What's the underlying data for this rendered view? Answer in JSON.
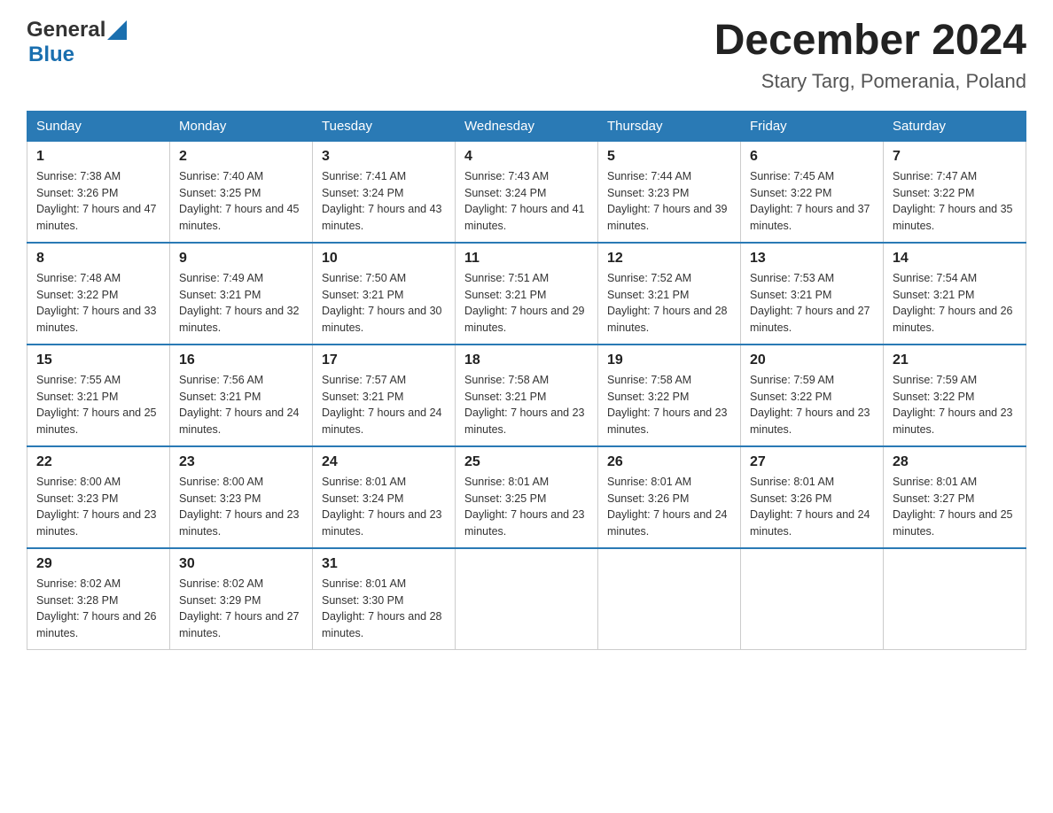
{
  "header": {
    "logo_general": "General",
    "logo_blue": "Blue",
    "title": "December 2024",
    "subtitle": "Stary Targ, Pomerania, Poland"
  },
  "days_of_week": [
    "Sunday",
    "Monday",
    "Tuesday",
    "Wednesday",
    "Thursday",
    "Friday",
    "Saturday"
  ],
  "weeks": [
    [
      {
        "day": "1",
        "sunrise": "7:38 AM",
        "sunset": "3:26 PM",
        "daylight": "7 hours and 47 minutes."
      },
      {
        "day": "2",
        "sunrise": "7:40 AM",
        "sunset": "3:25 PM",
        "daylight": "7 hours and 45 minutes."
      },
      {
        "day": "3",
        "sunrise": "7:41 AM",
        "sunset": "3:24 PM",
        "daylight": "7 hours and 43 minutes."
      },
      {
        "day": "4",
        "sunrise": "7:43 AM",
        "sunset": "3:24 PM",
        "daylight": "7 hours and 41 minutes."
      },
      {
        "day": "5",
        "sunrise": "7:44 AM",
        "sunset": "3:23 PM",
        "daylight": "7 hours and 39 minutes."
      },
      {
        "day": "6",
        "sunrise": "7:45 AM",
        "sunset": "3:22 PM",
        "daylight": "7 hours and 37 minutes."
      },
      {
        "day": "7",
        "sunrise": "7:47 AM",
        "sunset": "3:22 PM",
        "daylight": "7 hours and 35 minutes."
      }
    ],
    [
      {
        "day": "8",
        "sunrise": "7:48 AM",
        "sunset": "3:22 PM",
        "daylight": "7 hours and 33 minutes."
      },
      {
        "day": "9",
        "sunrise": "7:49 AM",
        "sunset": "3:21 PM",
        "daylight": "7 hours and 32 minutes."
      },
      {
        "day": "10",
        "sunrise": "7:50 AM",
        "sunset": "3:21 PM",
        "daylight": "7 hours and 30 minutes."
      },
      {
        "day": "11",
        "sunrise": "7:51 AM",
        "sunset": "3:21 PM",
        "daylight": "7 hours and 29 minutes."
      },
      {
        "day": "12",
        "sunrise": "7:52 AM",
        "sunset": "3:21 PM",
        "daylight": "7 hours and 28 minutes."
      },
      {
        "day": "13",
        "sunrise": "7:53 AM",
        "sunset": "3:21 PM",
        "daylight": "7 hours and 27 minutes."
      },
      {
        "day": "14",
        "sunrise": "7:54 AM",
        "sunset": "3:21 PM",
        "daylight": "7 hours and 26 minutes."
      }
    ],
    [
      {
        "day": "15",
        "sunrise": "7:55 AM",
        "sunset": "3:21 PM",
        "daylight": "7 hours and 25 minutes."
      },
      {
        "day": "16",
        "sunrise": "7:56 AM",
        "sunset": "3:21 PM",
        "daylight": "7 hours and 24 minutes."
      },
      {
        "day": "17",
        "sunrise": "7:57 AM",
        "sunset": "3:21 PM",
        "daylight": "7 hours and 24 minutes."
      },
      {
        "day": "18",
        "sunrise": "7:58 AM",
        "sunset": "3:21 PM",
        "daylight": "7 hours and 23 minutes."
      },
      {
        "day": "19",
        "sunrise": "7:58 AM",
        "sunset": "3:22 PM",
        "daylight": "7 hours and 23 minutes."
      },
      {
        "day": "20",
        "sunrise": "7:59 AM",
        "sunset": "3:22 PM",
        "daylight": "7 hours and 23 minutes."
      },
      {
        "day": "21",
        "sunrise": "7:59 AM",
        "sunset": "3:22 PM",
        "daylight": "7 hours and 23 minutes."
      }
    ],
    [
      {
        "day": "22",
        "sunrise": "8:00 AM",
        "sunset": "3:23 PM",
        "daylight": "7 hours and 23 minutes."
      },
      {
        "day": "23",
        "sunrise": "8:00 AM",
        "sunset": "3:23 PM",
        "daylight": "7 hours and 23 minutes."
      },
      {
        "day": "24",
        "sunrise": "8:01 AM",
        "sunset": "3:24 PM",
        "daylight": "7 hours and 23 minutes."
      },
      {
        "day": "25",
        "sunrise": "8:01 AM",
        "sunset": "3:25 PM",
        "daylight": "7 hours and 23 minutes."
      },
      {
        "day": "26",
        "sunrise": "8:01 AM",
        "sunset": "3:26 PM",
        "daylight": "7 hours and 24 minutes."
      },
      {
        "day": "27",
        "sunrise": "8:01 AM",
        "sunset": "3:26 PM",
        "daylight": "7 hours and 24 minutes."
      },
      {
        "day": "28",
        "sunrise": "8:01 AM",
        "sunset": "3:27 PM",
        "daylight": "7 hours and 25 minutes."
      }
    ],
    [
      {
        "day": "29",
        "sunrise": "8:02 AM",
        "sunset": "3:28 PM",
        "daylight": "7 hours and 26 minutes."
      },
      {
        "day": "30",
        "sunrise": "8:02 AM",
        "sunset": "3:29 PM",
        "daylight": "7 hours and 27 minutes."
      },
      {
        "day": "31",
        "sunrise": "8:01 AM",
        "sunset": "3:30 PM",
        "daylight": "7 hours and 28 minutes."
      },
      null,
      null,
      null,
      null
    ]
  ]
}
